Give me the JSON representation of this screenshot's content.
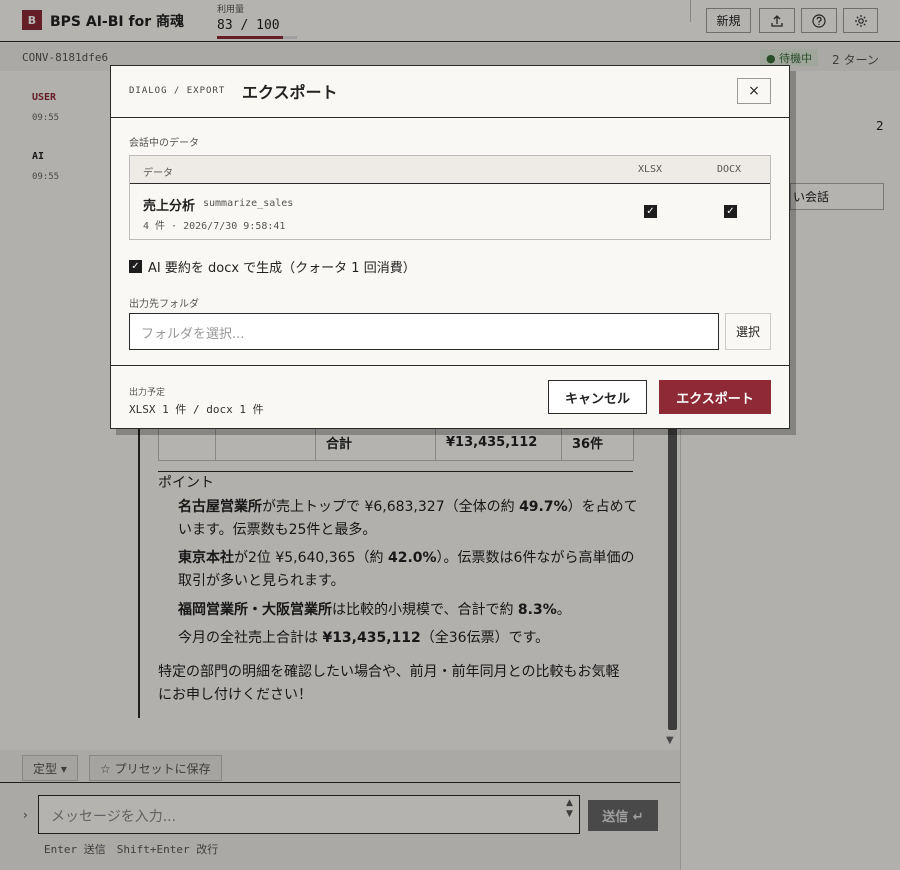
{
  "app": {
    "logo_letter": "B",
    "title": "BPS AI-BI for 商魂",
    "quota_label": "利用量",
    "quota_value": "83 / 100",
    "quota_fraction": 0.83,
    "toolbar": {
      "new_label": "新規"
    },
    "icons": [
      "upload-icon",
      "help-icon",
      "gear-icon"
    ]
  },
  "conversation": {
    "id": "CONV-8181dfe6",
    "status": "● 待機中",
    "turns": "2 ターン"
  },
  "sidebar": {
    "user_role": "USER",
    "user_time": "09:55",
    "ai_role": "AI",
    "ai_time": "09:55"
  },
  "right_panel": {
    "number": "2",
    "new_chat_partial": "い会話"
  },
  "message": {
    "total_row": {
      "label": "合計",
      "amount": "¥13,435,112",
      "count": "36件"
    },
    "points_title": "ポイント",
    "p1a": "名古屋営業所",
    "p1b": "が売上トップで ¥6,683,327（全体の約 ",
    "p1c": "49.7%",
    "p1d": "）を占めて",
    "p1e": "います。伝票数も25件と最多。",
    "p2a": "東京本社",
    "p2b": "が2位 ¥5,640,365（約 ",
    "p2c": "42.0%",
    "p2d": "）。伝票数は6件ながら高単価の",
    "p2e": "取引が多いと見られます。",
    "p3a": "福岡営業所・大阪営業所",
    "p3b": "は比較的小規模で、合計で約 ",
    "p3c": "8.3%",
    "p3d": "。",
    "p4a": "今月の全社売上合計は ",
    "p4b": "¥13,435,112",
    "p4c": "（全36伝票）です。",
    "closing1": "特定の部門の明細を確認したい場合や、前月・前年同月との比較もお気軽",
    "closing2": "にお申し付けください！"
  },
  "composer": {
    "preset_type": "定型 ▾",
    "save_preset": "☆ プリセットに保存",
    "placeholder": "メッセージを入力...",
    "send_label": "送信 ↵",
    "hint": "Enter 送信　Shift+Enter 改行"
  },
  "dialog": {
    "kicker": "DIALOG / EXPORT",
    "title": "エクスポート",
    "close_label": "×",
    "section_label": "会話中のデータ",
    "table_headers": {
      "data": "データ",
      "xlsx": "XLSX",
      "docx": "DOCX"
    },
    "dataset": {
      "name": "売上分析",
      "function": "summarize_sales",
      "meta": "4 件 · 2026/7/30 9:58:41",
      "xlsx_checked": true,
      "docx_checked": true
    },
    "ai_summary_label": "AI 要約を docx で生成（クォータ 1 回消費）",
    "ai_summary_checked": true,
    "folder_label": "出力先フォルダ",
    "folder_placeholder": "フォルダを選択...",
    "select_label": "選択",
    "planned_label": "出力予定",
    "planned_value": "XLSX 1 件 / docx 1 件",
    "cancel_label": "キャンセル",
    "export_label": "エクスポート"
  },
  "colors": {
    "accent": "#8e2a35",
    "ink": "#2a2a2a",
    "paper": "#faf8f4"
  }
}
